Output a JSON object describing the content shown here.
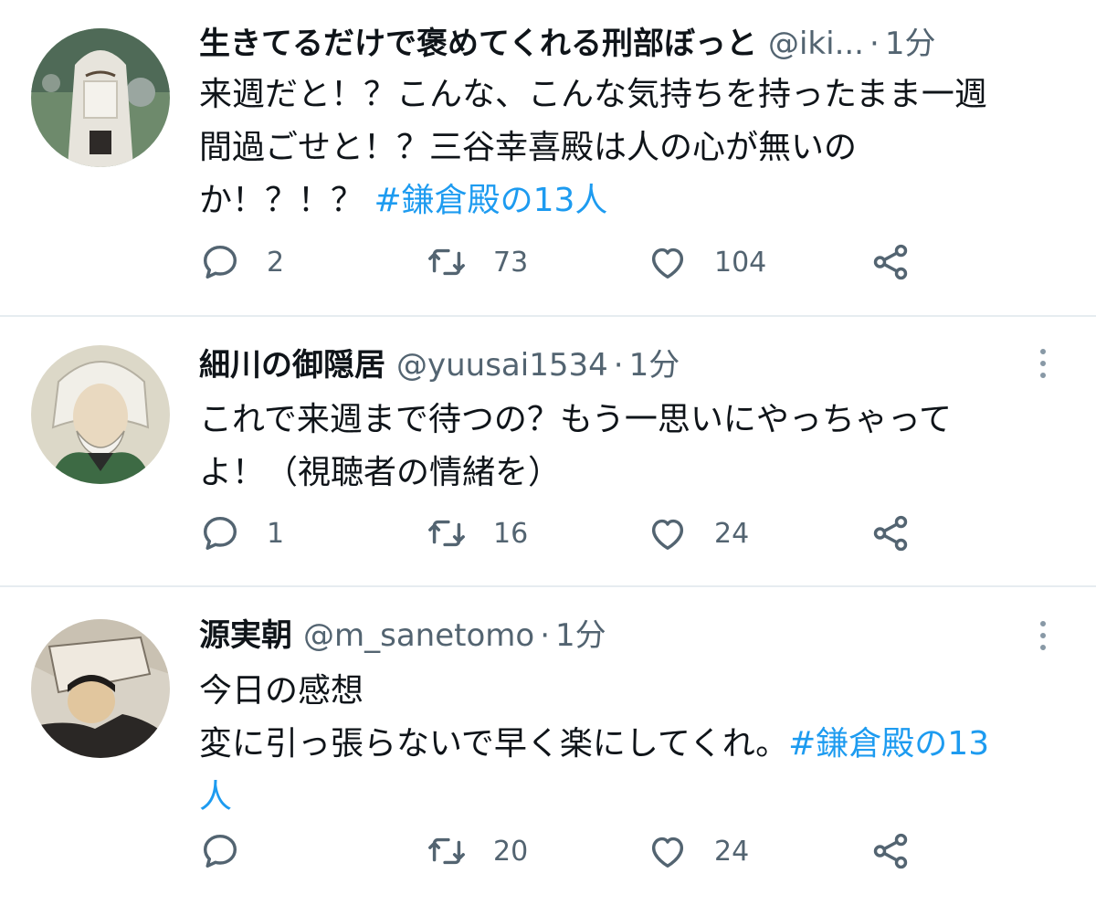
{
  "colors": {
    "accent": "#1d9bf0",
    "muted": "#536471",
    "text": "#0f1419",
    "divider": "#e6ecf0"
  },
  "tweets": [
    {
      "display_name": "生きてるだけで褒めてくれる刑部ぼっと",
      "handle": "@iki...",
      "dot": "·",
      "time": "1分",
      "text_lines": [
        "来週だと！？こんな、こんな気持ちを持ったまま一週",
        "間過ごせと！？三谷幸喜殿は人の心が無いの",
        "か！？！？ "
      ],
      "hashtag": "#鎌倉殿の13人",
      "reply_count": "2",
      "retweet_count": "73",
      "like_count": "104",
      "icons": [
        "reply-icon",
        "retweet-icon",
        "like-icon",
        "share-icon"
      ]
    },
    {
      "display_name": "細川の御隠居",
      "handle": "@yuusai1534",
      "dot": "·",
      "time": "1分",
      "text_lines": [
        "これで来週まで待つの？もう一思いにやっちゃって",
        "よ！（視聴者の情緒を）"
      ],
      "hashtag": "",
      "reply_count": "1",
      "retweet_count": "16",
      "like_count": "24",
      "icons": [
        "reply-icon",
        "retweet-icon",
        "like-icon",
        "share-icon",
        "more-icon"
      ]
    },
    {
      "display_name": "源実朝",
      "handle": "@m_sanetomo",
      "dot": "·",
      "time": "1分",
      "text_lines": [
        "今日の感想",
        "変に引っ張らないで早く楽にしてくれ。"
      ],
      "hashtag_part1": "#鎌倉殿の13",
      "hashtag_part2": "人",
      "reply_count": "",
      "retweet_count": "20",
      "like_count": "24",
      "icons": [
        "reply-icon",
        "retweet-icon",
        "like-icon",
        "share-icon",
        "more-icon"
      ]
    }
  ]
}
